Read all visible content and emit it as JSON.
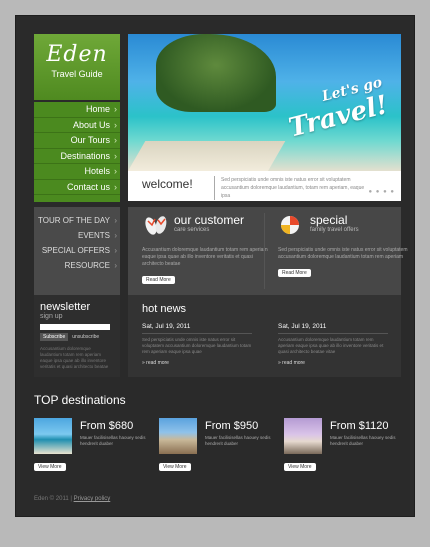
{
  "brand": {
    "name": "Eden",
    "tagline": "Travel Guide"
  },
  "nav": [
    {
      "label": "Home"
    },
    {
      "label": "About Us"
    },
    {
      "label": "Our Tours"
    },
    {
      "label": "Destinations"
    },
    {
      "label": "Hotels"
    },
    {
      "label": "Contact us"
    }
  ],
  "hero": {
    "headline_line1": "Let's go",
    "headline_line2": "Travel!",
    "welcome_label": "welcome!",
    "welcome_text": "Sed perspiciatis unde omnis iste natus error sit voluptatem accusantium doloremque laudantium, totam rem aperiam, eaque ipsa"
  },
  "tours": [
    {
      "label": "TOUR OF THE DAY"
    },
    {
      "label": "EVENTS"
    },
    {
      "label": "SPECIAL OFFERS"
    },
    {
      "label": "RESOURCE"
    }
  ],
  "care": {
    "title": "our customer",
    "subtitle": "care services",
    "text": "Accusantium doloremque laudantium totam rem aperiam eaque ipsa quae ab illo inventore veritatis et quasi architecto beatae",
    "button": "Read More"
  },
  "special": {
    "title": "special",
    "subtitle": "family travel offers",
    "text": "Sed perspiciatis unde omnis iste natus error sit voluptatem accusantium doloremque laudantium totam rem aperiam",
    "button": "Read More"
  },
  "newsletter": {
    "title": "newsletter",
    "subtitle": "sign up",
    "subscribe": "Subscribe",
    "unsubscribe": "unsubscribe",
    "text": "Accusantium doloremque laudantium totam rem aperiam eaque ipsa quae ab illo inventore veritatis et quasi architecto beatae"
  },
  "hot_news": {
    "title": "hot news",
    "items": [
      {
        "date": "Sat, Jul 19, 2011",
        "text": "Sed perspiciatis unde omnis iste natus error sit voluptatem accusantium doloremque laudantium totam rem aperiam eaque ipsa quae",
        "more": "» read more"
      },
      {
        "date": "Sat, Jul 19, 2011",
        "text": "Accusantium doloremque laudantium totam rem aperiam eaque ipsa quae ab illo inventore veritatis et quasi architecto beatae vitae",
        "more": "» read more"
      }
    ]
  },
  "top_destinations": {
    "title": "TOP destinations",
    "items": [
      {
        "price": "From $680",
        "desc": "Mauer facilisisellas haouey sedis hendrerit duaber",
        "button": "View More"
      },
      {
        "price": "From $950",
        "desc": "Mauer facilisisellas haouey sedis hendrerit duaber",
        "button": "View More"
      },
      {
        "price": "From $1120",
        "desc": "Mauer facilisisellas haouey sedis hendrerit duaber",
        "button": "View More"
      }
    ]
  },
  "footer": {
    "copyright": "Eden © 2011 |",
    "privacy": "Privacy policy"
  }
}
